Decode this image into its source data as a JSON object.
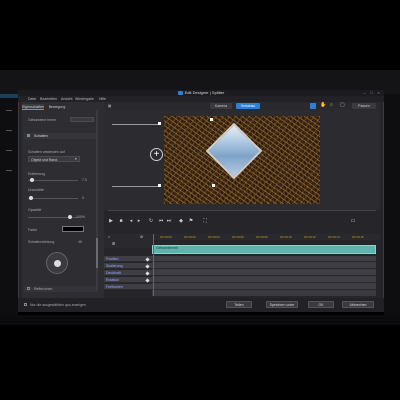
{
  "window": {
    "title": "Edit Designer | Splitter",
    "logo": "CL"
  },
  "menu": [
    "Datei",
    "Bearbeiten",
    "Ansicht",
    "Wiedergabe",
    "Hilfe"
  ],
  "left_panel": {
    "tabs": [
      "Eigenschaften",
      "Bewegung"
    ],
    "field1_label": "Gebundene Innen",
    "section_label": "Schatten",
    "shadow_apply_label": "Schatten anwenden auf",
    "shadow_apply_value": "Objekt und Rand",
    "distance_label": "Entfernung",
    "distance_value": "7.0",
    "blur_label": "Unschärfe",
    "blur_value": "3",
    "opacity_label": "Opazität",
    "opacity_value": "100%",
    "color_label": "Farbe",
    "direction_label": "Schattenrichtung",
    "direction_value": "45",
    "bottom_section": "Reflexionen"
  },
  "preview": {
    "pills": [
      "Kamera",
      "Vorschau"
    ],
    "zoom": "Passen"
  },
  "timeline": {
    "ticks": [
      "00:00:00",
      "00:00:02",
      "00:00:04",
      "00:00:06",
      "00:00:08",
      "00:00:10",
      "00:00:12",
      "00:00:14",
      "00:00:16"
    ],
    "clip_label": "Gebundenheit",
    "tracks": [
      "Position",
      "Skalierung",
      "Deckkraft",
      "Rotation",
      "Freiformen"
    ]
  },
  "footer": {
    "checkbox_label": "Nur die ausgewählten quo anzeigen",
    "buttons": [
      "Teilen",
      "Speichern unter",
      "OK",
      "Abbrechen"
    ]
  }
}
